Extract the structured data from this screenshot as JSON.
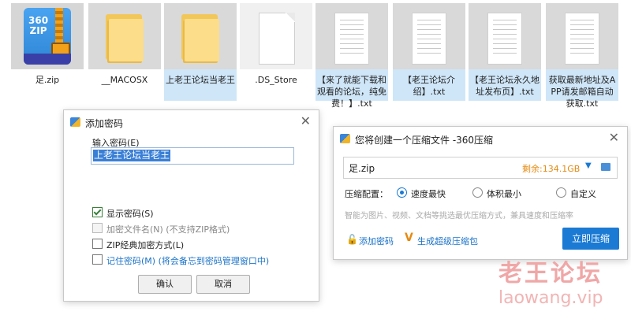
{
  "files": [
    {
      "name": "足.zip",
      "kind": "zip",
      "icon": "zip-archive-icon",
      "zip_badge": "360\nZIP"
    },
    {
      "name": "__MACOSX",
      "kind": "folder",
      "icon": "folder-icon"
    },
    {
      "name": "上老王论坛当老王",
      "kind": "folder",
      "icon": "folder-icon"
    },
    {
      "name": ".DS_Store",
      "kind": "blank",
      "icon": "file-icon"
    },
    {
      "name": "【来了就能下载和观看的论坛，纯免费！】.txt",
      "kind": "txt",
      "icon": "text-file-icon"
    },
    {
      "name": "【老王论坛介绍】.txt",
      "kind": "txt",
      "icon": "text-file-icon"
    },
    {
      "name": "【老王论坛永久地址发布页】.txt",
      "kind": "txt",
      "icon": "text-file-icon"
    },
    {
      "name": "获取最新地址及APP请发邮箱自动获取.txt",
      "kind": "txt",
      "icon": "text-file-icon"
    }
  ],
  "password_dialog": {
    "title": "添加密码",
    "close_glyph": "✕",
    "input_label": "输入密码(E)",
    "input_value": "上老王论坛当老王",
    "options": [
      {
        "label": "显示密码(S)",
        "checked": true,
        "disabled": false
      },
      {
        "label": "加密文件名(N) (不支持ZIP格式)",
        "checked": false,
        "disabled": true
      },
      {
        "label": "ZIP经典加密方式(L)",
        "checked": false,
        "disabled": false
      },
      {
        "label": "记住密码(M)",
        "suffix": "(将会备忘到密码管理窗口中)",
        "checked": false,
        "disabled": false
      }
    ],
    "ok_label": "确认",
    "cancel_label": "取消"
  },
  "compress_dialog": {
    "title": "您将创建一个压缩文件 -360压缩",
    "close_glyph": "✕",
    "filename": "足.zip",
    "remaining": "剩余:134.1GB",
    "config_label": "压缩配置：",
    "modes": [
      {
        "label": "速度最快",
        "selected": true
      },
      {
        "label": "体积最小",
        "selected": false
      },
      {
        "label": "自定义",
        "selected": false
      }
    ],
    "hint": "智能为图片、视频、文档等挑选最优压缩方式，兼具速度和压缩率",
    "add_password_label": "添加密码",
    "super_pack_label": "生成超级压缩包",
    "compress_button": "立即压缩"
  },
  "watermark": {
    "cn": "老王论坛",
    "url": "laowang.vip"
  },
  "colors": {
    "accent": "#1a7ad4",
    "orange": "#e58a12",
    "link": "#1a73c8",
    "watermark": "#f0a7a7"
  }
}
